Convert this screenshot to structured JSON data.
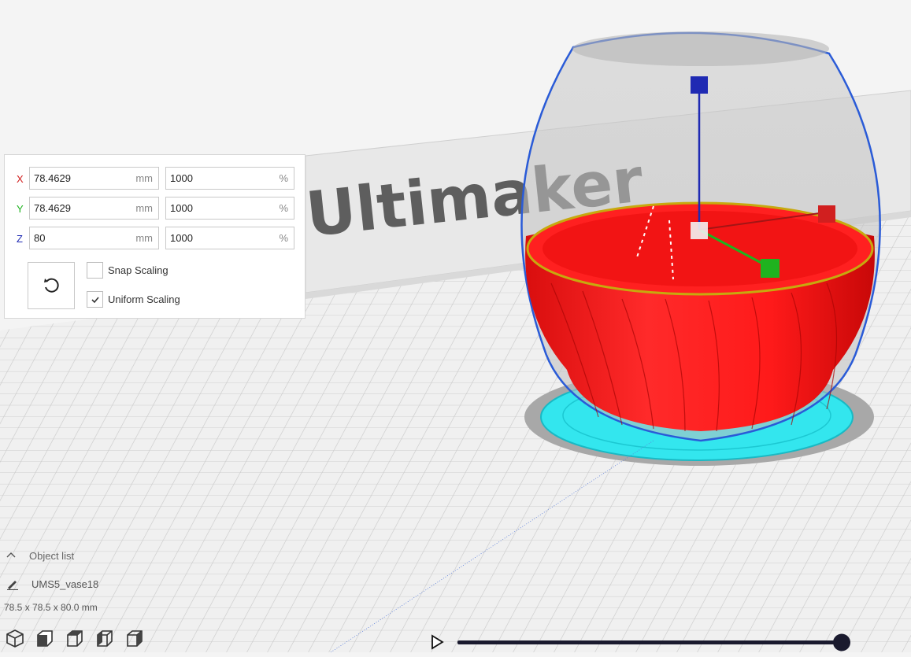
{
  "viewport": {
    "brand_text": "Ultimaker",
    "colors": {
      "background": "#f4f4f4",
      "grid_line": "#c9c9c9",
      "model": "#ff1f1f",
      "brim": "#33e6ee",
      "shadow": "#a8a8a8",
      "selection_outline": "#2a5bd7",
      "axis_x": "#d11f1f",
      "axis_y": "#1fb31f",
      "axis_z": "#1f2ab3"
    }
  },
  "scale_panel": {
    "x": {
      "label": "X",
      "mm_value": "78.4629",
      "mm_unit": "mm",
      "pct_value": "1000",
      "pct_unit": "%"
    },
    "y": {
      "label": "Y",
      "mm_value": "78.4629",
      "mm_unit": "mm",
      "pct_value": "1000",
      "pct_unit": "%"
    },
    "z": {
      "label": "Z",
      "mm_value": "80",
      "mm_unit": "mm",
      "pct_value": "1000",
      "pct_unit": "%"
    },
    "reset_icon": "reset-icon",
    "snap_scaling": {
      "label": "Snap Scaling",
      "checked": false
    },
    "uniform_scaling": {
      "label": "Uniform Scaling",
      "checked": true
    }
  },
  "object_list": {
    "header": "Object list",
    "object_name": "UMS5_vase18",
    "dimensions": "78.5 x 78.5 x 80.0 mm"
  },
  "view_buttons": [
    "3d-view-icon",
    "front-view-icon",
    "top-view-icon",
    "left-view-icon",
    "right-view-icon"
  ],
  "playback": {
    "progress": 1.0
  }
}
